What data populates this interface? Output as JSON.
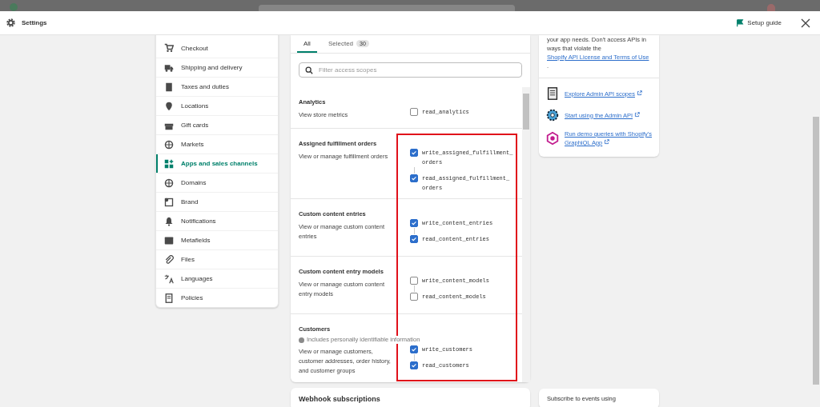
{
  "window": {
    "title": "Settings",
    "setup_guide": "Setup guide"
  },
  "sidebar": {
    "items": [
      {
        "label": "Checkout",
        "selected": false
      },
      {
        "label": "Shipping and delivery",
        "selected": false
      },
      {
        "label": "Taxes and duties",
        "selected": false
      },
      {
        "label": "Locations",
        "selected": false
      },
      {
        "label": "Gift cards",
        "selected": false
      },
      {
        "label": "Markets",
        "selected": false
      },
      {
        "label": "Apps and sales channels",
        "selected": true
      },
      {
        "label": "Domains",
        "selected": false
      },
      {
        "label": "Brand",
        "selected": false
      },
      {
        "label": "Notifications",
        "selected": false
      },
      {
        "label": "Metafields",
        "selected": false
      },
      {
        "label": "Files",
        "selected": false
      },
      {
        "label": "Languages",
        "selected": false
      },
      {
        "label": "Policies",
        "selected": false
      }
    ]
  },
  "scopes_panel": {
    "tabs": [
      {
        "label": "All",
        "selected": true
      },
      {
        "label": "Selected",
        "count": "30",
        "selected": false
      }
    ],
    "search": {
      "placeholder": "Filter access scopes"
    },
    "sections": [
      {
        "title": "Analytics",
        "description": "View store metrics",
        "scopes": [
          {
            "name": "read_analytics",
            "checked": false
          }
        ]
      },
      {
        "title": "Assigned fulfillment orders",
        "description": "View or manage fulfillment orders",
        "scopes": [
          {
            "name": "write_assigned_fulfillment_ orders",
            "checked": true
          },
          {
            "name": "read_assigned_fulfillment_ orders",
            "checked": true
          }
        ]
      },
      {
        "title": "Custom content entries",
        "description": "View or manage custom content entries",
        "scopes": [
          {
            "name": "write_content_entries",
            "checked": true
          },
          {
            "name": "read_content_entries",
            "checked": true
          }
        ]
      },
      {
        "title": "Custom content entry models",
        "description": "View or manage custom content entry models",
        "scopes": [
          {
            "name": "write_content_models",
            "checked": false
          },
          {
            "name": "read_content_models",
            "checked": false
          }
        ]
      },
      {
        "title": "Customers",
        "notice": "Includes personally identifiable information",
        "description": "View or manage customers, customer addresses, order history, and customer groups",
        "scopes": [
          {
            "name": "write_customers",
            "checked": true
          },
          {
            "name": "read_customers",
            "checked": true
          }
        ]
      }
    ]
  },
  "webhook_card": {
    "title": "Webhook subscriptions"
  },
  "info_card": {
    "text_before": "your app needs. Don't access APIs in ways that violate the",
    "link": "Shopify API License and Terms of Use",
    "text_after": ".",
    "links": [
      {
        "label": "Explore Admin API scopes"
      },
      {
        "label": "Start using the Admin API"
      },
      {
        "label": "Run demo queries with Shopify's GraphiQL App"
      }
    ]
  },
  "webhook_info": {
    "text": "Subscribe to events using"
  }
}
